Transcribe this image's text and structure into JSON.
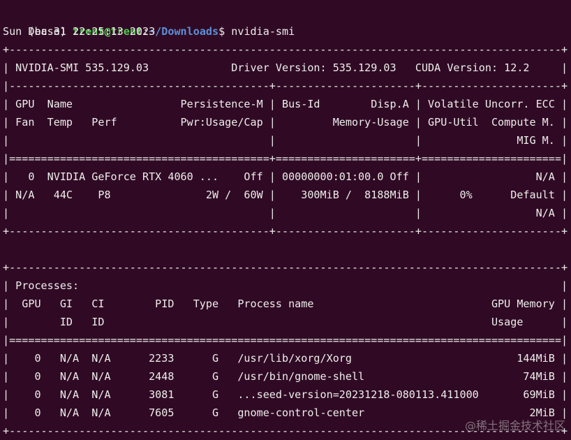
{
  "prompt": {
    "env": "(base) ",
    "user_host": "trent@trent",
    "separator": ":",
    "path": "~/Downloads",
    "sign": "$ ",
    "command": "nvidia-smi"
  },
  "output": {
    "date": "Sun Dec 31 22:25:13 2023",
    "lines": [
      "+---------------------------------------------------------------------------------------+",
      "| NVIDIA-SMI 535.129.03             Driver Version: 535.129.03   CUDA Version: 12.2     |",
      "|-----------------------------------------+----------------------+----------------------+",
      "| GPU  Name                 Persistence-M | Bus-Id        Disp.A | Volatile Uncorr. ECC |",
      "| Fan  Temp   Perf          Pwr:Usage/Cap |         Memory-Usage | GPU-Util  Compute M. |",
      "|                                         |                      |               MIG M. |",
      "|=========================================+======================+======================|",
      "|   0  NVIDIA GeForce RTX 4060 ...    Off | 00000000:01:00.0 Off |                  N/A |",
      "| N/A   44C    P8               2W /  60W |    300MiB /  8188MiB |      0%      Default |",
      "|                                         |                      |                  N/A |",
      "+-----------------------------------------+----------------------+----------------------+",
      "",
      "+---------------------------------------------------------------------------------------+",
      "| Processes:                                                                            |",
      "|  GPU   GI   CI        PID   Type   Process name                            GPU Memory |",
      "|        ID   ID                                                             Usage      |",
      "|=======================================================================================|",
      "|    0   N/A  N/A      2233      G   /usr/lib/xorg/Xorg                          144MiB |",
      "|    0   N/A  N/A      2448      G   /usr/bin/gnome-shell                         74MiB |",
      "|    0   N/A  N/A      3081      G   ...seed-version=20231218-080113.411000       69MiB |",
      "|    0   N/A  N/A      7605      G   gnome-control-center                          2MiB |",
      "+---------------------------------------------------------------------------------------+"
    ]
  },
  "watermark": "@稀土掘金技术社区"
}
